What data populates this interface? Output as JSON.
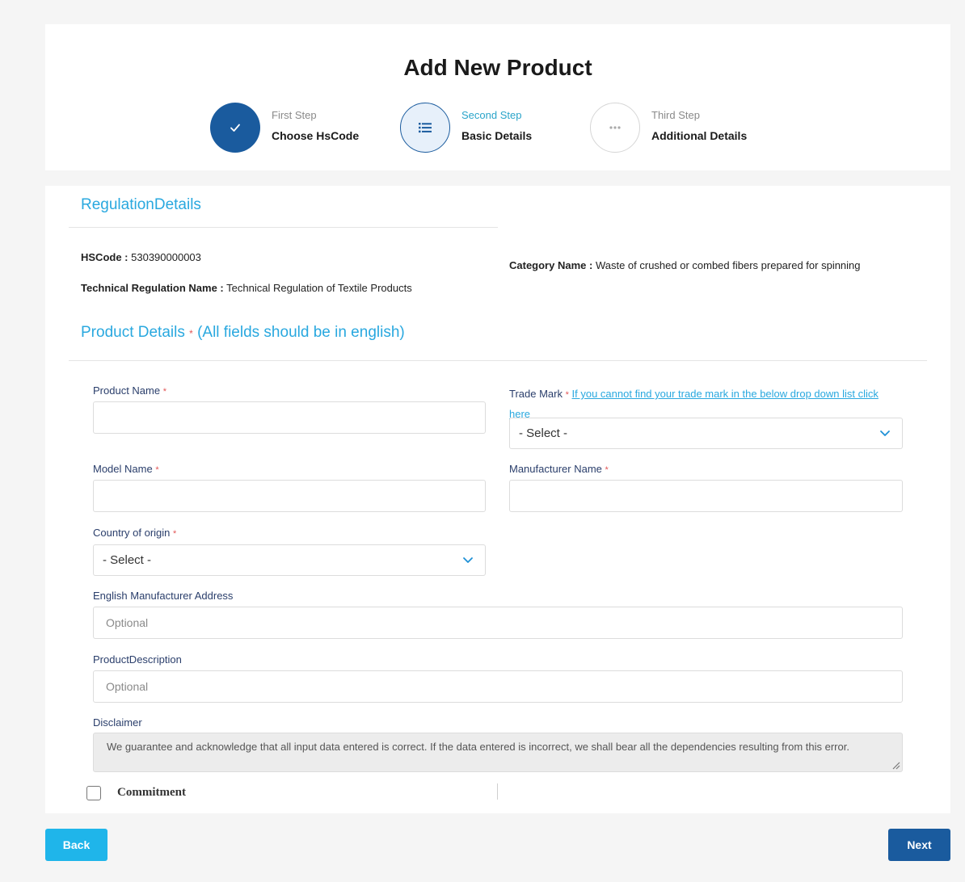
{
  "page": {
    "title": "Add New Product"
  },
  "steps": [
    {
      "small": "First Step",
      "big": "Choose HsCode",
      "state": "done",
      "icon": "check-icon"
    },
    {
      "small": "Second Step",
      "big": "Basic Details",
      "state": "active",
      "icon": "list-icon"
    },
    {
      "small": "Third Step",
      "big": "Additional Details",
      "state": "pending",
      "icon": "dots-icon"
    }
  ],
  "regulation": {
    "title": "RegulationDetails",
    "hscode_label": "HSCode :",
    "hscode_value": "530390000003",
    "category_label": "Category Name :",
    "category_value": "Waste of crushed or combed fibers prepared for spinning",
    "tech_label": "Technical Regulation Name :",
    "tech_value": "Technical Regulation of Textile Products"
  },
  "product": {
    "title": "Product Details",
    "title_note": "(All fields should be in english)",
    "required_mark": "*"
  },
  "form": {
    "product_name_label": "Product Name",
    "trade_mark_label": "Trade Mark",
    "trade_mark_link": "If you cannot find your trade mark in the below drop down list click",
    "trade_mark_link2": "here",
    "trade_mark_value": "- Select -",
    "model_name_label": "Model Name",
    "manufacturer_name_label": "Manufacturer Name",
    "country_label": "Country of origin",
    "country_value": "- Select -",
    "address_label": "English Manufacturer Address",
    "address_placeholder": "Optional",
    "description_label": "ProductDescription",
    "description_placeholder": "Optional",
    "disclaimer_label": "Disclaimer",
    "disclaimer_text": "We guarantee and acknowledge that all input data entered is correct. If the data entered is incorrect, we shall bear all the dependencies resulting from this error.",
    "commitment_label": "Commitment"
  },
  "buttons": {
    "back": "Back",
    "next": "Next"
  },
  "colors": {
    "primary": "#1a5b9e",
    "accent": "#29a8df",
    "back_button": "#1fb5ea",
    "required": "#e25656"
  }
}
